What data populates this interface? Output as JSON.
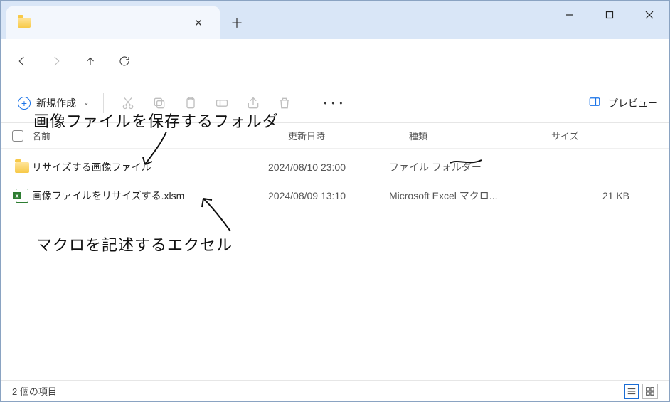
{
  "tab": {
    "title": ""
  },
  "toolbar": {
    "new_label": "新規作成",
    "preview_label": "プレビュー"
  },
  "columns": {
    "name": "名前",
    "date": "更新日時",
    "type": "種類",
    "size": "サイズ"
  },
  "items": [
    {
      "icon": "folder",
      "name": "リサイズする画像ファイル",
      "date": "2024/08/10 23:00",
      "type": "ファイル フォルダー",
      "size": ""
    },
    {
      "icon": "xlsm",
      "name": "画像ファイルをリサイズする.xlsm",
      "date": "2024/08/09 13:10",
      "type": "Microsoft Excel マクロ...",
      "size": "21 KB"
    }
  ],
  "status": {
    "count_text": "2 個の項目"
  },
  "annotations": {
    "top": "画像ファイルを保存するフォルダ",
    "bottom": "マクロを記述するエクセル"
  }
}
